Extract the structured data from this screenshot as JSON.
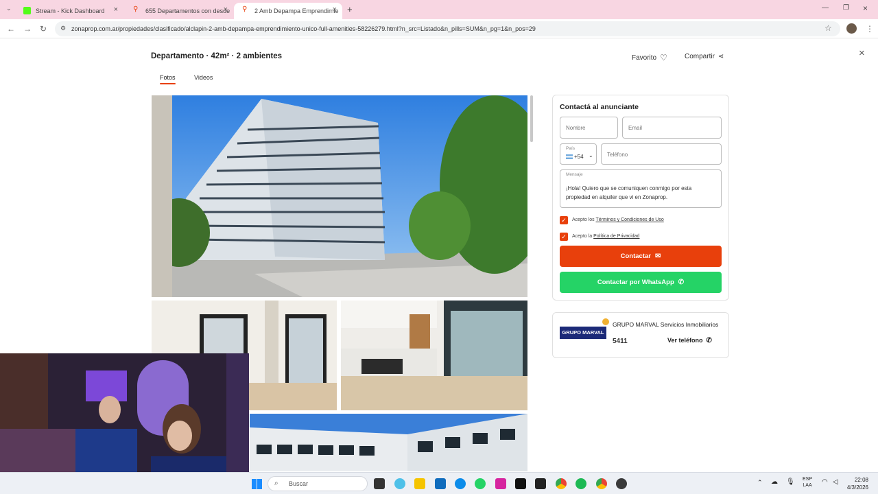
{
  "browser": {
    "tabs": [
      {
        "title": "Stream - Kick Dashboard",
        "fav_color": "#53fc18"
      },
      {
        "title": "655 Departamentos con desde",
        "fav_color": "#e8400c"
      },
      {
        "title": "2 Amb Depampa Emprendimie",
        "fav_color": "#e8400c"
      }
    ],
    "url": "zonaprop.com.ar/propiedades/clasificado/alclapin-2-amb-depampa-emprendimiento-unico-full-amenities-58226279.html?n_src=Listado&n_pills=SUM&n_pg=1&n_pos=29"
  },
  "listing": {
    "title": "Departamento · 42m² · 2 ambientes",
    "favorite_label": "Favorito",
    "share_label": "Compartir",
    "media_tabs": [
      "Fotos",
      "Videos"
    ]
  },
  "contact": {
    "heading": "Contactá al anunciante",
    "name_placeholder": "Nombre",
    "email_placeholder": "Email",
    "country_label": "País",
    "country_code": "+54",
    "phone_placeholder": "Teléfono",
    "message_label": "Mensaje",
    "message_text": "¡Hola! Quiero que se comuniquen conmigo por esta propiedad en alquiler que vi en Zonaprop.",
    "terms_prefix": "Acepto los",
    "terms_link": "Términos y Condiciones de Uso",
    "privacy_prefix": "Acepto la",
    "privacy_link": "Política de Privacidad",
    "contact_button": "Contactar",
    "whatsapp_button": "Contactar por WhatsApp",
    "accent": "#e8400c",
    "whatsapp_color": "#25d366"
  },
  "advertiser": {
    "logo_text": "GRUPO MARVAL",
    "name": "GRUPO MARVAL Servicios Inmobiliarios",
    "phone_partial": "5411",
    "phone_button": "Ver teléfono"
  },
  "taskbar": {
    "search_placeholder": "Buscar",
    "lang_top": "ESP",
    "lang_bottom": "LAA",
    "time": "22:08",
    "date": "4/3/2026"
  }
}
